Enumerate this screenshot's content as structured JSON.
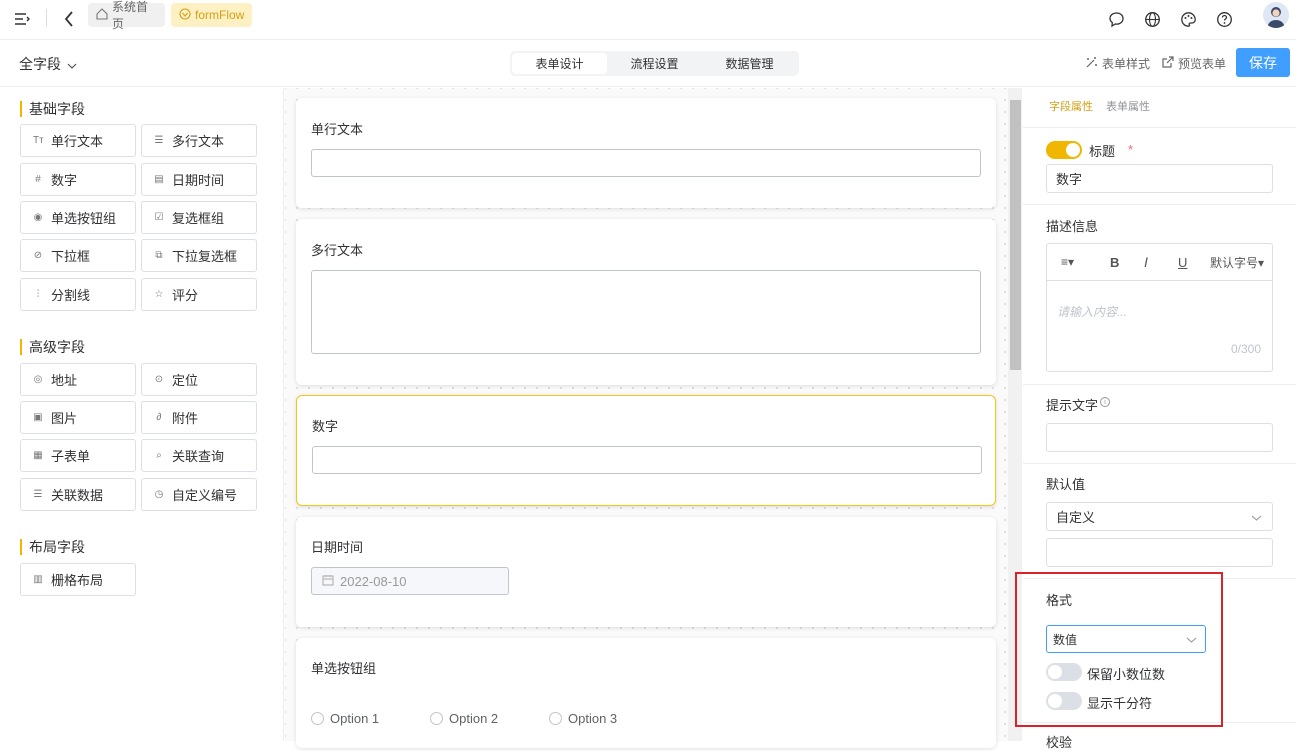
{
  "topbar": {
    "home_tab": "系统首页",
    "flow_tab": "formFlow"
  },
  "subbar": {
    "field_filter": "全字段",
    "segments": [
      "表单设计",
      "流程设置",
      "数据管理"
    ],
    "form_style": "表单样式",
    "preview": "预览表单",
    "save": "保存"
  },
  "left": {
    "basic_title": "基础字段",
    "basic": [
      "单行文本",
      "多行文本",
      "数字",
      "日期时间",
      "单选按钮组",
      "复选框组",
      "下拉框",
      "下拉复选框",
      "分割线",
      "评分"
    ],
    "advanced_title": "高级字段",
    "advanced": [
      "地址",
      "定位",
      "图片",
      "附件",
      "子表单",
      "关联查询",
      "关联数据",
      "自定义编号"
    ],
    "layout_title": "布局字段",
    "layout": [
      "栅格布局"
    ]
  },
  "canvas": {
    "cards": [
      {
        "label": "单行文本"
      },
      {
        "label": "多行文本"
      },
      {
        "label": "数字"
      },
      {
        "label": "日期时间",
        "value": "2022-08-10"
      },
      {
        "label": "单选按钮组",
        "options": [
          "Option 1",
          "Option 2",
          "Option 3"
        ]
      }
    ]
  },
  "right": {
    "tabs": [
      "字段属性",
      "表单属性"
    ],
    "title_label": "标题",
    "required_mark": "*",
    "title_value": "数字",
    "desc_label": "描述信息",
    "editor_font": "默认字号",
    "editor_placeholder": "请输入内容...",
    "editor_count": "0/300",
    "hint_label": "提示文字",
    "default_label": "默认值",
    "default_select": "自定义",
    "format_label": "格式",
    "format_select": "数值",
    "decimal_label": "保留小数位数",
    "thousand_label": "显示千分符",
    "validate_label": "校验"
  },
  "colors": {
    "accent": "#f1b600",
    "primary": "#409eff",
    "highlight": "#d9222a"
  }
}
